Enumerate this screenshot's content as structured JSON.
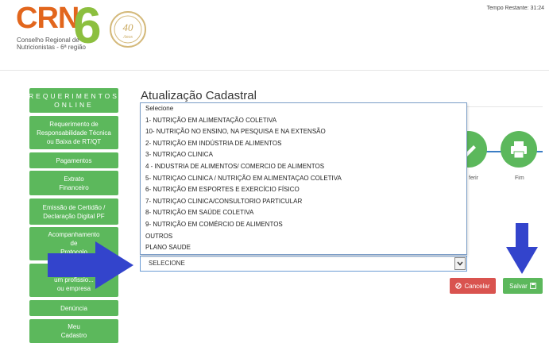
{
  "header": {
    "logo_text": "CRN",
    "logo_number": "6",
    "logo_sub_line1": "Conselho Regional de",
    "logo_sub_line2": "Nutricionistas - 6ª região",
    "seal_number": "40",
    "seal_text": "Anos",
    "timer": "Tempo Restante: 31:24"
  },
  "sidebar": {
    "heading_line1": "REQUERIMENTOS",
    "heading_line2": "ONLINE",
    "items": [
      {
        "line1": "Requerimento de",
        "line2": "Responsabilidade Técnica",
        "line3": "ou Baixa de RT/QT"
      },
      {
        "line1": "Pagamentos"
      },
      {
        "line1": "Extrato",
        "line2": "Financeiro"
      },
      {
        "line1": "Emissão de Certidão /",
        "line2": "Declaração Digital PF"
      },
      {
        "line1": "Acompanhamento",
        "line2": "de",
        "line3": "Protocolo"
      },
      {
        "line1": "um profissio...",
        "line2": "ou empresa"
      },
      {
        "line1": "Denúncia"
      },
      {
        "line1": "Meu",
        "line2": "Cadastro"
      }
    ]
  },
  "main": {
    "title": "Atualização Cadastral",
    "steps": [
      {
        "label": "ferir"
      },
      {
        "label": "Fim"
      }
    ]
  },
  "dropdown": {
    "options": [
      "Selecione",
      "1- NUTRIÇÃO EM ALIMENTAÇÃO COLETIVA",
      "10- NUTRIÇÃO NO ENSINO, NA PESQUISA E NA EXTENSÃO",
      "2- NUTRIÇÃO EM INDÚSTRIA DE ALIMENTOS",
      "3- NUTRIÇAO CLINICA",
      "4 - INDUSTRIA DE ALIMENTOS/ COMERCIO DE ALIMENTOS",
      "5- NUTRIÇAO CLINICA / NUTRIÇÃO EM ALIMENTAÇAO COLETIVA",
      "6- NUTRIÇÃO EM ESPORTES E EXERCÍCIO FÍSICO",
      "7- NUTRIÇAO CLINICA/CONSULTORIO PARTICULAR",
      "8- NUTRIÇÃO EM SAÚDE COLETIVA",
      "9- NUTRIÇÃO EM COMÉRCIO DE ALIMENTOS",
      "OUTROS",
      "PLANO SAUDE"
    ],
    "selected": "SELECIONE"
  },
  "buttons": {
    "cancel": "Cancelar",
    "save": "Salvar"
  },
  "colors": {
    "brand_orange": "#e2661d",
    "brand_green": "#8cbf3f",
    "sidebar_green": "#5cb85c",
    "danger": "#d9534f",
    "annotation_arrow": "#3344cc"
  }
}
